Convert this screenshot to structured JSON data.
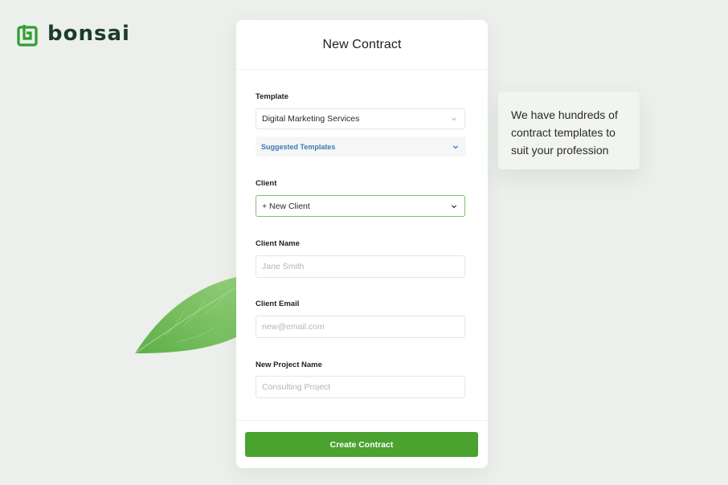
{
  "brand": {
    "name": "bonsai",
    "color": "#2f9e2f",
    "logo_icon": "bonsai-logo-icon"
  },
  "colors": {
    "background": "#ecefeb",
    "primary_button": "#4aa22f",
    "link_blue": "#3e78b7",
    "active_border": "#7cc46a"
  },
  "contract_form": {
    "title": "New Contract",
    "template": {
      "label": "Template",
      "value": "Digital Marketing Services",
      "icon": "chevron-down-icon"
    },
    "suggested_templates": {
      "label": "Suggested Templates",
      "icon": "chevron-down-icon"
    },
    "client": {
      "label": "Client",
      "value": "+ New Client",
      "icon": "chevron-down-icon"
    },
    "client_name": {
      "label": "Client Name",
      "placeholder": "Jane Smith"
    },
    "client_email": {
      "label": "Client Email",
      "placeholder": "new@email.com"
    },
    "project_name": {
      "label": "New Project Name",
      "placeholder": "Consulting Project"
    },
    "submit_label": "Create Contract"
  },
  "tooltip": {
    "text": "We have hundreds of contract templates to suit your profession"
  }
}
